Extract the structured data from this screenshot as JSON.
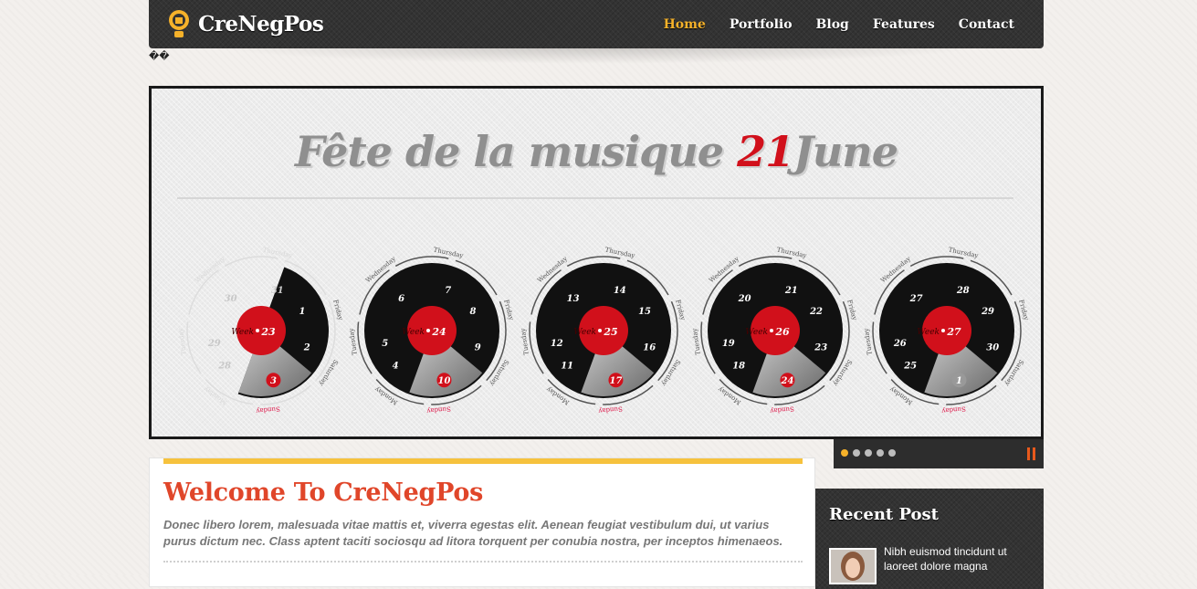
{
  "site": {
    "name": "CreNegPos"
  },
  "nav": {
    "items": [
      "Home",
      "Portfolio",
      "Blog",
      "Features",
      "Contact"
    ],
    "active": "Home"
  },
  "garbled_text": "��",
  "slide": {
    "title_part1": "Fête de la musique",
    "title_number": "21",
    "title_part2": "June",
    "clocks": [
      {
        "week": "23",
        "dates": [
          "28",
          "29",
          "30",
          "31",
          "1",
          "2",
          "3"
        ],
        "highlight": "3"
      },
      {
        "week": "24",
        "dates": [
          "4",
          "5",
          "6",
          "7",
          "8",
          "9",
          "10"
        ],
        "highlight": "10"
      },
      {
        "week": "25",
        "dates": [
          "11",
          "12",
          "13",
          "14",
          "15",
          "16",
          "17"
        ],
        "highlight": "17"
      },
      {
        "week": "26",
        "dates": [
          "18",
          "19",
          "20",
          "21",
          "22",
          "23",
          "24"
        ],
        "highlight": "24"
      },
      {
        "week": "27",
        "dates": [
          "25",
          "26",
          "27",
          "28",
          "29",
          "30",
          "1"
        ],
        "highlight": "1"
      }
    ],
    "day_labels": [
      "Monday",
      "Tuesday",
      "Wednesday",
      "Thursday",
      "Friday",
      "Saturday",
      "Sunday"
    ],
    "week_label": "Week"
  },
  "slider_nav": {
    "dots": 5,
    "active_index": 0
  },
  "welcome": {
    "heading": "Welcome To CreNegPos",
    "text": "Donec libero lorem, malesuada vitae mattis et, viverra egestas elit. Aenean feugiat vestibulum dui, ut varius purus dictum nec. Class aptent taciti sociosqu ad litora torquent per conubia nostra, per inceptos himenaeos."
  },
  "recent": {
    "heading": "Recent Post",
    "post_title": "Nibh euismod tincidunt ut laoreet dolore magna"
  },
  "colors": {
    "accent": "#f6b22a",
    "heading_red": "#e0462a",
    "clock_red": "#d1101b",
    "dark": "#333333"
  }
}
